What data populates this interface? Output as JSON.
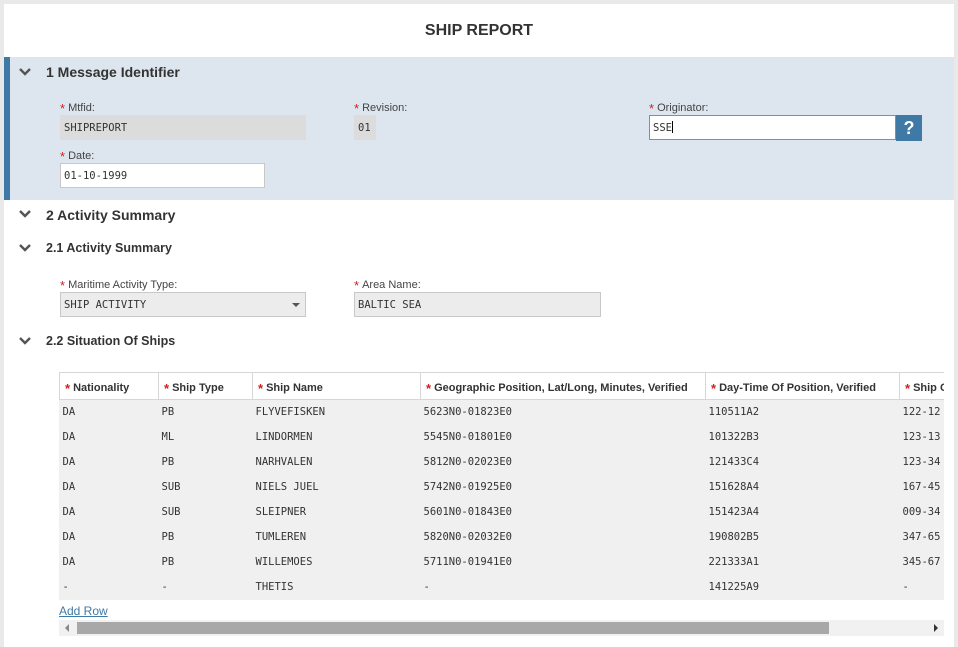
{
  "report_title": "SHIP REPORT",
  "section1": {
    "title": "1 Message Identifier",
    "mtfid": {
      "label": "Mtfid:",
      "value": "SHIPREPORT"
    },
    "revision": {
      "label": "Revision:",
      "value": "01"
    },
    "originator": {
      "label": "Originator:",
      "value": "SSE",
      "help": "?"
    },
    "date": {
      "label": "Date:",
      "value": "01-10-1999"
    }
  },
  "section2": {
    "title": "2 Activity Summary",
    "sub1": {
      "title": "2.1 Activity Summary",
      "maritime_activity_type": {
        "label": "Maritime Activity Type:",
        "value": "SHIP ACTIVITY"
      },
      "area_name": {
        "label": "Area Name:",
        "value": "BALTIC SEA"
      }
    },
    "sub2": {
      "title": "2.2 Situation Of Ships",
      "columns": [
        "Nationality",
        "Ship Type",
        "Ship Name",
        "Geographic Position, Lat/Long, Minutes, Verified",
        "Day-Time Of Position, Verified",
        "Ship Course, Speed"
      ],
      "rows": [
        [
          "DA",
          "PB",
          "FLYVEFISKEN",
          "5623N0-01823E0",
          "110511A2",
          "122-12"
        ],
        [
          "DA",
          "ML",
          "LINDORMEN",
          "5545N0-01801E0",
          "101322B3",
          "123-13"
        ],
        [
          "DA",
          "PB",
          "NARHVALEN",
          "5812N0-02023E0",
          "121433C4",
          "123-34"
        ],
        [
          "DA",
          "SUB",
          "NIELS JUEL",
          "5742N0-01925E0",
          "151628A4",
          "167-45"
        ],
        [
          "DA",
          "SUB",
          "SLEIPNER",
          "5601N0-01843E0",
          "151423A4",
          "009-34"
        ],
        [
          "DA",
          "PB",
          "TUMLEREN",
          "5820N0-02032E0",
          "190802B5",
          "347-65"
        ],
        [
          "DA",
          "PB",
          "WILLEMOES",
          "5711N0-01941E0",
          "221333A1",
          "345-67"
        ],
        [
          "-",
          "-",
          "THETIS",
          "-",
          "141225A9",
          "-"
        ]
      ],
      "add_row_label": "Add Row"
    }
  },
  "required_marker": "*",
  "colors": {
    "accent": "#3f7aa6",
    "section_bg": "#dde6ee",
    "required": "#cc2222"
  },
  "icons": {
    "section_toggle": "chevron-down-icon",
    "dropdown": "caret-down-icon",
    "scroll_left": "arrow-left-icon",
    "scroll_right": "arrow-right-icon"
  }
}
